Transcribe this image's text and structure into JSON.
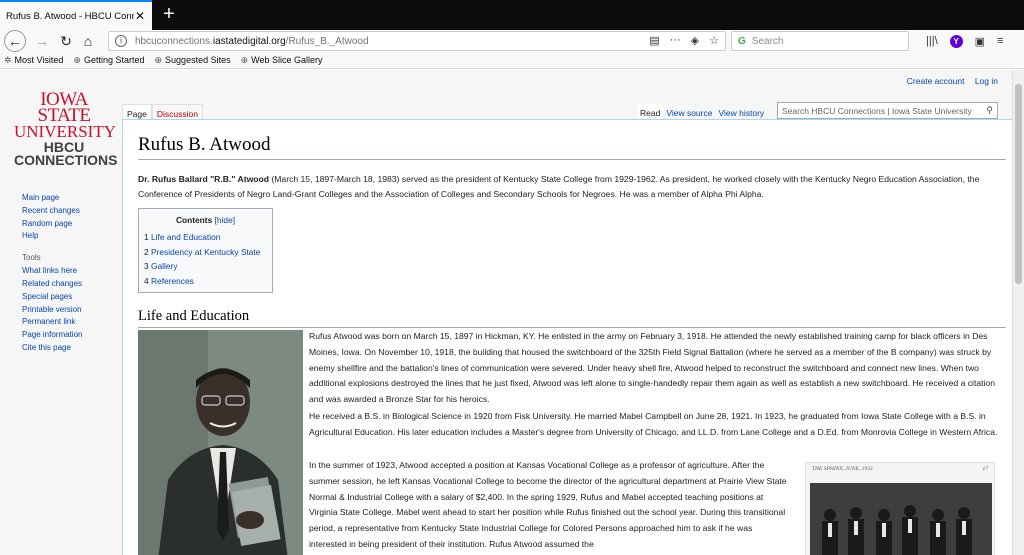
{
  "browser": {
    "tab_title": "Rufus B. Atwood - HBCU Connectio",
    "tab_close": "✕",
    "new_tab": "+",
    "url_prefix": "hbcuconnections.",
    "url_host": "iastatedigital.org",
    "url_path": "/Rufus_B._Atwood",
    "search_placeholder": "Search",
    "bookmarks": [
      "Most Visited",
      "Getting Started",
      "Suggested Sites",
      "Web Slice Gallery"
    ]
  },
  "wiki": {
    "logo": {
      "line1": "IOWA STATE",
      "line2": "UNIVERSITY",
      "line3": "HBCU",
      "line4": "CONNECTIONS"
    },
    "personal": {
      "create_account": "Create account",
      "login": "Log in"
    },
    "tabs": {
      "page": "Page",
      "discussion": "Discussion",
      "read": "Read",
      "view_source": "View source",
      "view_history": "View history"
    },
    "search_placeholder": "Search HBCU Connections | Iowa State University",
    "sidebar": {
      "nav": [
        "Main page",
        "Recent changes",
        "Random page",
        "Help"
      ],
      "tools_header": "Tools",
      "tools": [
        "What links here",
        "Related changes",
        "Special pages",
        "Printable version",
        "Permanent link",
        "Page information",
        "Cite this page"
      ]
    },
    "title": "Rufus B. Atwood",
    "lead_bold": "Dr. Rufus Ballard \"R.B.\" Atwood",
    "lead_rest": " (March 15, 1897-March 18, 1983) served as the president of Kentucky State College from 1929-1962. As president, he worked closely with the Kentucky Negro Education Association, the Conference of Presidents of Negro Land-Grant Colleges and the Association of Colleges and Secondary Schools for Negroes. He was a member of Alpha Phi Alpha.",
    "toc": {
      "title": "Contents",
      "hide": "[hide]",
      "items": [
        {
          "num": "1",
          "label": "Life and Education"
        },
        {
          "num": "2",
          "label": "Presidency at Kentucky State"
        },
        {
          "num": "3",
          "label": "Gallery"
        },
        {
          "num": "4",
          "label": "References"
        }
      ]
    },
    "section_title": "Life and Education",
    "paragraphs": [
      "Rufus Atwood was born on March 15, 1897 in Hickman, KY. He enlisted in the army on February 3, 1918. He attended the newly established training camp for black officers in Des Moines, Iowa. On November 10, 1918, the building that housed the switchboard of the 325th Field Signal Battalion (where he served as a member of the B company) was struck by enemy shellfire and the battalion's lines of communication were severed. Under heavy shell fire, Atwood helped to reconstruct the switchboard and connect new lines. When two additional explosions destroyed the lines that he just fixed, Atwood was left alone to single-handedly repair them again as well as establish a new switchboard. He received a citation and was awarded a Bronze Star for his heroics.",
      "He received a B.S. in Biological Science in 1920 from Fisk University. He married Mabel Campbell on June 28, 1921. In 1923, he graduated from Iowa State College with a B.S. in Agricultural Education. His later education includes a Master's degree from University of Chicago, and LL.D. from Lane College and a D.Ed. from Monrovia College in Western Africa.",
      "In the summer of 1923, Atwood accepted a position at Kansas Vocational College as a professor of agriculture. After the summer session, he left Kansas Vocational College to become the director of the agricultural department at Prairie View State Normal & Industrial College with a salary of $2,400. In the spring 1929, Rufus and Mabel accepted teaching positions at Virginia State College. Mabel went ahead to start her position while Rufus finished out the school year. During this transitional period, a representative from Kentucky State Industrial College for Colored Persons approached him to ask if he was interested in being president of their institution. Rufus Atwood assumed the"
    ],
    "clipping_caption_left": "THE SPHINX, JUNE, 1933",
    "clipping_caption_right": "17"
  }
}
